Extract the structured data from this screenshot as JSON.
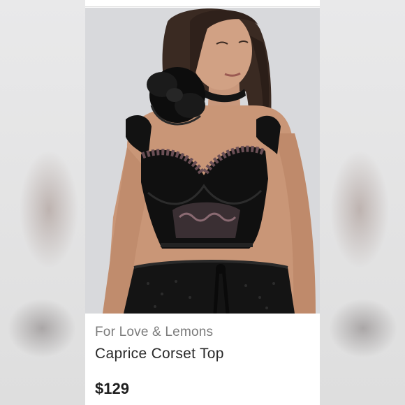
{
  "listing": {
    "brand": "For Love & Lemons",
    "title": "Caprice Corset Top",
    "price": "$129"
  },
  "colors": {
    "page_background": "#ececec",
    "card_background": "#ffffff",
    "brand_text": "#7b7b7b",
    "title_text": "#2a2a2a",
    "price_text": "#1e1e1e",
    "photo_background": "#d9dadd"
  },
  "image": {
    "subject": "product-photo"
  }
}
